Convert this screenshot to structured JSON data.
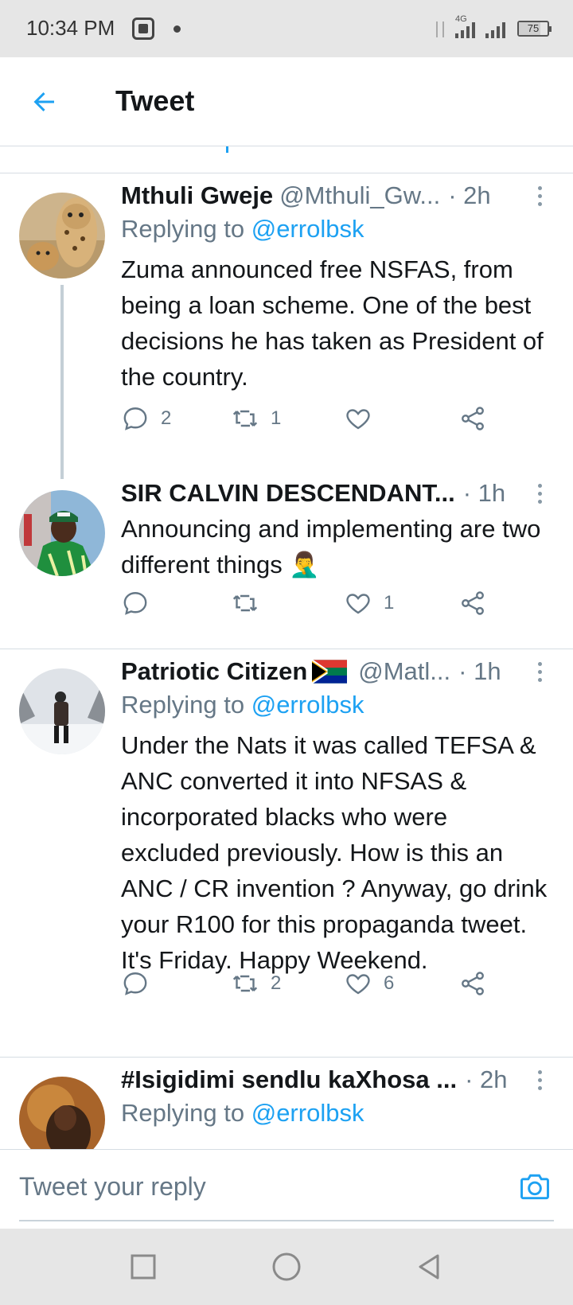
{
  "status_bar": {
    "time": "10:34 PM",
    "network": "4G",
    "battery": "75",
    "battery_level": 0.75
  },
  "header": {
    "title": "Tweet",
    "back_icon": "arrow-left-icon"
  },
  "colors": {
    "accent": "#1da1f2",
    "secondary_text": "#657786",
    "divider": "#d6dde3"
  },
  "tweets": [
    {
      "display_name": "Mthuli Gweje",
      "handle": "@Mthuli_Gw...",
      "time": "· 2h",
      "replying_label": "Replying to",
      "replying_to": "@errolbsk",
      "text": "Zuma announced free NSFAS, from being a loan scheme. One of the best decisions he has taken as President of the country.",
      "replies": "2",
      "retweets": "1",
      "likes": ""
    },
    {
      "display_name": "SIR CALVIN DESCENDANT...",
      "time": "· 1h",
      "text": "Announcing  and implementing are two different things 🤦‍♂️",
      "replies": "",
      "retweets": "",
      "likes": "1"
    },
    {
      "display_name": "Patriotic Citizen",
      "handle": "@Matl...",
      "time": "· 1h",
      "replying_label": "Replying to",
      "replying_to": "@errolbsk",
      "text": "Under the Nats it was called TEFSA & ANC converted it into NFSAS & incorporated blacks who were excluded previously. How is this an ANC / CR invention ? Anyway, go drink your R100 for this propaganda tweet. It's Friday. Happy Weekend.",
      "replies": "",
      "retweets": "2",
      "likes": "6"
    },
    {
      "display_name": "#Isigidimi sendlu kaXhosa ...",
      "time": "· 2h",
      "replying_label": "Replying to",
      "replying_to": "@errolbsk"
    }
  ],
  "reply_bar": {
    "placeholder": "Tweet your reply"
  }
}
